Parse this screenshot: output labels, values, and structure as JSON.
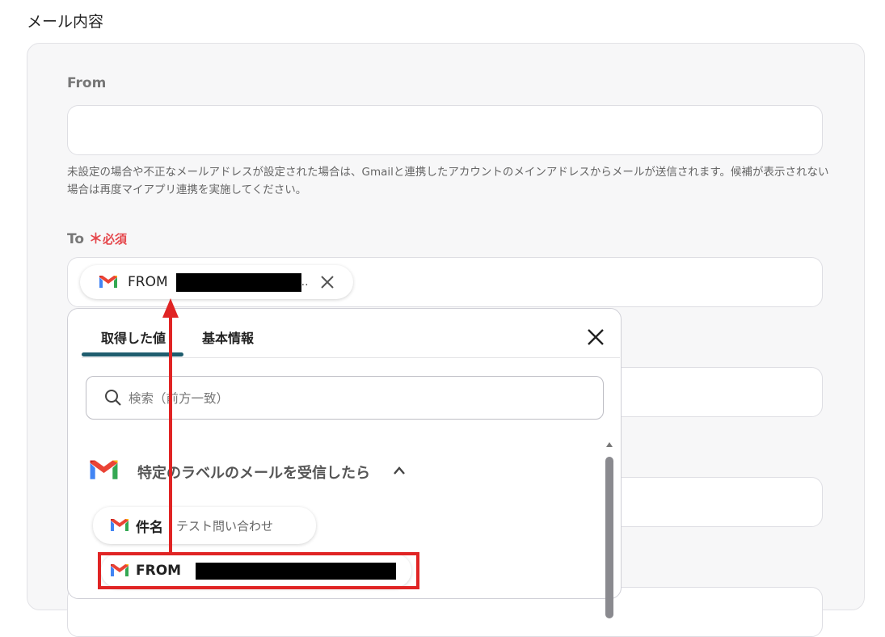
{
  "section": {
    "title": "メール内容"
  },
  "from": {
    "label": "From",
    "value": "",
    "help": "未設定の場合や不正なメールアドレスが設定された場合は、Gmailと連携したアカウントのメインアドレスからメールが送信されます。候補が表示されない場合は再度マイアプリ連携を実施してください。"
  },
  "to": {
    "label": "To",
    "required_star": "＊",
    "required_text": "必須",
    "chip": {
      "label": "FROM",
      "ellipsis": "..",
      "icon": "gmail-icon",
      "remove_icon": "close-icon"
    }
  },
  "dropdown": {
    "tabs": [
      {
        "label": "取得した値",
        "active": true
      },
      {
        "label": "基本情報",
        "active": false
      }
    ],
    "search_placeholder": "検索（前方一致）",
    "group": {
      "title": "特定のラベルのメールを受信したら",
      "icon": "gmail-icon",
      "expanded": true
    },
    "items": [
      {
        "label": "件名",
        "value": "テスト問い合わせ"
      },
      {
        "label": "FROM",
        "value": ""
      }
    ]
  },
  "colors": {
    "accent": "#1f5d6e",
    "required": "#e5484d",
    "annotation": "#e02424"
  }
}
